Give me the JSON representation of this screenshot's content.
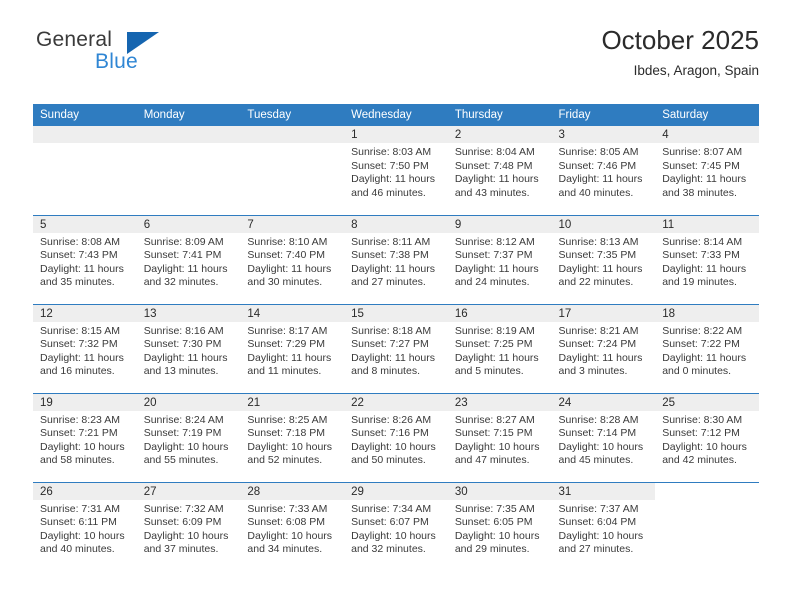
{
  "brand": {
    "name_top": "General",
    "name_bottom": "Blue",
    "triangle_color": "#1565b0",
    "blue_color": "#2f86d4"
  },
  "header": {
    "title": "October 2025",
    "subtitle": "Ibdes, Aragon, Spain"
  },
  "theme": {
    "header_bg": "#2f7cc0",
    "daynum_bg": "#eeeeee",
    "grid_line": "#2f7cc0",
    "text": "#2b2b2b"
  },
  "weekday_headers": [
    "Sunday",
    "Monday",
    "Tuesday",
    "Wednesday",
    "Thursday",
    "Friday",
    "Saturday"
  ],
  "weeks": [
    [
      {
        "day": "",
        "lines": []
      },
      {
        "day": "",
        "lines": []
      },
      {
        "day": "",
        "lines": []
      },
      {
        "day": "1",
        "lines": [
          "Sunrise: 8:03 AM",
          "Sunset: 7:50 PM",
          "Daylight: 11 hours",
          "and 46 minutes."
        ]
      },
      {
        "day": "2",
        "lines": [
          "Sunrise: 8:04 AM",
          "Sunset: 7:48 PM",
          "Daylight: 11 hours",
          "and 43 minutes."
        ]
      },
      {
        "day": "3",
        "lines": [
          "Sunrise: 8:05 AM",
          "Sunset: 7:46 PM",
          "Daylight: 11 hours",
          "and 40 minutes."
        ]
      },
      {
        "day": "4",
        "lines": [
          "Sunrise: 8:07 AM",
          "Sunset: 7:45 PM",
          "Daylight: 11 hours",
          "and 38 minutes."
        ]
      }
    ],
    [
      {
        "day": "5",
        "lines": [
          "Sunrise: 8:08 AM",
          "Sunset: 7:43 PM",
          "Daylight: 11 hours",
          "and 35 minutes."
        ]
      },
      {
        "day": "6",
        "lines": [
          "Sunrise: 8:09 AM",
          "Sunset: 7:41 PM",
          "Daylight: 11 hours",
          "and 32 minutes."
        ]
      },
      {
        "day": "7",
        "lines": [
          "Sunrise: 8:10 AM",
          "Sunset: 7:40 PM",
          "Daylight: 11 hours",
          "and 30 minutes."
        ]
      },
      {
        "day": "8",
        "lines": [
          "Sunrise: 8:11 AM",
          "Sunset: 7:38 PM",
          "Daylight: 11 hours",
          "and 27 minutes."
        ]
      },
      {
        "day": "9",
        "lines": [
          "Sunrise: 8:12 AM",
          "Sunset: 7:37 PM",
          "Daylight: 11 hours",
          "and 24 minutes."
        ]
      },
      {
        "day": "10",
        "lines": [
          "Sunrise: 8:13 AM",
          "Sunset: 7:35 PM",
          "Daylight: 11 hours",
          "and 22 minutes."
        ]
      },
      {
        "day": "11",
        "lines": [
          "Sunrise: 8:14 AM",
          "Sunset: 7:33 PM",
          "Daylight: 11 hours",
          "and 19 minutes."
        ]
      }
    ],
    [
      {
        "day": "12",
        "lines": [
          "Sunrise: 8:15 AM",
          "Sunset: 7:32 PM",
          "Daylight: 11 hours",
          "and 16 minutes."
        ]
      },
      {
        "day": "13",
        "lines": [
          "Sunrise: 8:16 AM",
          "Sunset: 7:30 PM",
          "Daylight: 11 hours",
          "and 13 minutes."
        ]
      },
      {
        "day": "14",
        "lines": [
          "Sunrise: 8:17 AM",
          "Sunset: 7:29 PM",
          "Daylight: 11 hours",
          "and 11 minutes."
        ]
      },
      {
        "day": "15",
        "lines": [
          "Sunrise: 8:18 AM",
          "Sunset: 7:27 PM",
          "Daylight: 11 hours",
          "and 8 minutes."
        ]
      },
      {
        "day": "16",
        "lines": [
          "Sunrise: 8:19 AM",
          "Sunset: 7:25 PM",
          "Daylight: 11 hours",
          "and 5 minutes."
        ]
      },
      {
        "day": "17",
        "lines": [
          "Sunrise: 8:21 AM",
          "Sunset: 7:24 PM",
          "Daylight: 11 hours",
          "and 3 minutes."
        ]
      },
      {
        "day": "18",
        "lines": [
          "Sunrise: 8:22 AM",
          "Sunset: 7:22 PM",
          "Daylight: 11 hours",
          "and 0 minutes."
        ]
      }
    ],
    [
      {
        "day": "19",
        "lines": [
          "Sunrise: 8:23 AM",
          "Sunset: 7:21 PM",
          "Daylight: 10 hours",
          "and 58 minutes."
        ]
      },
      {
        "day": "20",
        "lines": [
          "Sunrise: 8:24 AM",
          "Sunset: 7:19 PM",
          "Daylight: 10 hours",
          "and 55 minutes."
        ]
      },
      {
        "day": "21",
        "lines": [
          "Sunrise: 8:25 AM",
          "Sunset: 7:18 PM",
          "Daylight: 10 hours",
          "and 52 minutes."
        ]
      },
      {
        "day": "22",
        "lines": [
          "Sunrise: 8:26 AM",
          "Sunset: 7:16 PM",
          "Daylight: 10 hours",
          "and 50 minutes."
        ]
      },
      {
        "day": "23",
        "lines": [
          "Sunrise: 8:27 AM",
          "Sunset: 7:15 PM",
          "Daylight: 10 hours",
          "and 47 minutes."
        ]
      },
      {
        "day": "24",
        "lines": [
          "Sunrise: 8:28 AM",
          "Sunset: 7:14 PM",
          "Daylight: 10 hours",
          "and 45 minutes."
        ]
      },
      {
        "day": "25",
        "lines": [
          "Sunrise: 8:30 AM",
          "Sunset: 7:12 PM",
          "Daylight: 10 hours",
          "and 42 minutes."
        ]
      }
    ],
    [
      {
        "day": "26",
        "lines": [
          "Sunrise: 7:31 AM",
          "Sunset: 6:11 PM",
          "Daylight: 10 hours",
          "and 40 minutes."
        ]
      },
      {
        "day": "27",
        "lines": [
          "Sunrise: 7:32 AM",
          "Sunset: 6:09 PM",
          "Daylight: 10 hours",
          "and 37 minutes."
        ]
      },
      {
        "day": "28",
        "lines": [
          "Sunrise: 7:33 AM",
          "Sunset: 6:08 PM",
          "Daylight: 10 hours",
          "and 34 minutes."
        ]
      },
      {
        "day": "29",
        "lines": [
          "Sunrise: 7:34 AM",
          "Sunset: 6:07 PM",
          "Daylight: 10 hours",
          "and 32 minutes."
        ]
      },
      {
        "day": "30",
        "lines": [
          "Sunrise: 7:35 AM",
          "Sunset: 6:05 PM",
          "Daylight: 10 hours",
          "and 29 minutes."
        ]
      },
      {
        "day": "31",
        "lines": [
          "Sunrise: 7:37 AM",
          "Sunset: 6:04 PM",
          "Daylight: 10 hours",
          "and 27 minutes."
        ]
      },
      {
        "day": "",
        "lines": []
      }
    ]
  ]
}
